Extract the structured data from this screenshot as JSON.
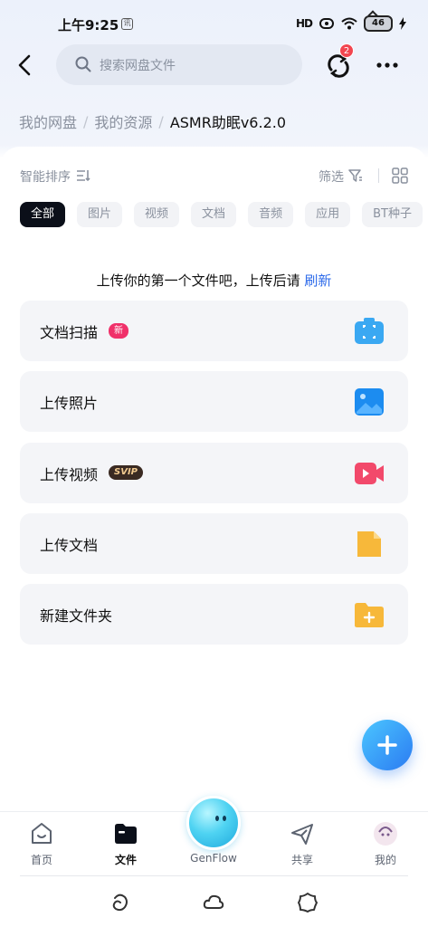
{
  "status_bar": {
    "time": "上午9:25",
    "note": "讯",
    "signal": "HD",
    "battery": "46"
  },
  "top_bar": {
    "search_placeholder": "搜索网盘文件",
    "sync_badge": "2"
  },
  "breadcrumb": [
    "我的网盘",
    "我的资源",
    "ASMR助眠v6.2.0"
  ],
  "toolbar": {
    "sort_label": "智能排序",
    "filter_label": "筛选"
  },
  "chips": [
    "全部",
    "图片",
    "视频",
    "文档",
    "音频",
    "应用",
    "BT种子"
  ],
  "empty_state": {
    "hint": "上传你的第一个文件吧，上传后请",
    "link": "刷新"
  },
  "actions": [
    {
      "label": "文档扫描",
      "tag": "新",
      "icon": "scan-icon",
      "color": "#2f9bf0"
    },
    {
      "label": "上传照片",
      "icon": "photo-icon",
      "color": "#1c8cf0"
    },
    {
      "label": "上传视频",
      "tag": "SVIP",
      "icon": "video-icon",
      "color": "#f2496b"
    },
    {
      "label": "上传文档",
      "icon": "document-icon",
      "color": "#f7b83a"
    },
    {
      "label": "新建文件夹",
      "icon": "new-folder-icon",
      "color": "#f7b83a"
    }
  ],
  "tab_bar": {
    "home": "首页",
    "files": "文件",
    "genflow": "GenFlow",
    "share": "共享",
    "mine": "我的"
  },
  "colors": {
    "accent": "#2e6bea",
    "active_chip": "#0b0f19",
    "badge": "#f24650"
  }
}
